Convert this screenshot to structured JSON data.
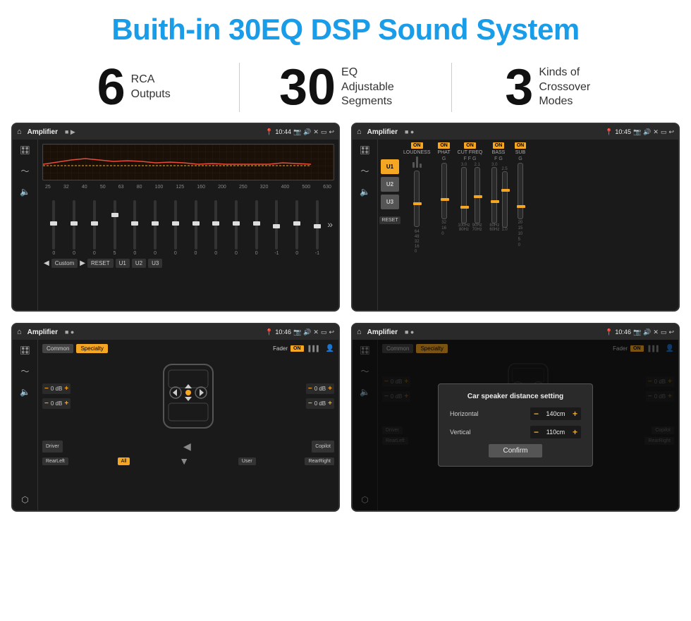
{
  "title": "Buith-in 30EQ DSP Sound System",
  "stats": [
    {
      "number": "6",
      "label": "RCA\nOutputs"
    },
    {
      "number": "30",
      "label": "EQ Adjustable\nSegments"
    },
    {
      "number": "3",
      "label": "Kinds of\nCrossover Modes"
    }
  ],
  "screens": [
    {
      "id": "screen1",
      "app_name": "Amplifier",
      "time": "10:44",
      "type": "eq",
      "freq_labels": [
        "25",
        "32",
        "40",
        "50",
        "63",
        "80",
        "100",
        "125",
        "160",
        "200",
        "250",
        "320",
        "400",
        "500",
        "630"
      ],
      "slider_values": [
        "0",
        "0",
        "0",
        "5",
        "0",
        "0",
        "0",
        "0",
        "0",
        "0",
        "0",
        "-1",
        "0",
        "-1"
      ],
      "bottom_btns": [
        "Custom",
        "RESET",
        "U1",
        "U2",
        "U3"
      ]
    },
    {
      "id": "screen2",
      "app_name": "Amplifier",
      "time": "10:45",
      "type": "amplifier",
      "presets": [
        "U1",
        "U2",
        "U3"
      ],
      "channels": [
        {
          "name": "LOUDNESS",
          "on": true
        },
        {
          "name": "PHAT",
          "on": true
        },
        {
          "name": "CUT FREQ",
          "on": true
        },
        {
          "name": "BASS",
          "on": true
        },
        {
          "name": "SUB",
          "on": true
        }
      ]
    },
    {
      "id": "screen3",
      "app_name": "Amplifier",
      "time": "10:46",
      "type": "fader",
      "tabs": [
        "Common",
        "Specialty"
      ],
      "active_tab": "Specialty",
      "fader_label": "Fader",
      "fader_on": true,
      "speakers": [
        {
          "label": "0 dB",
          "side": "left-top"
        },
        {
          "label": "0 dB",
          "side": "left-bottom"
        },
        {
          "label": "0 dB",
          "side": "right-top"
        },
        {
          "label": "0 dB",
          "side": "right-bottom"
        }
      ],
      "bottom_labels": [
        "Driver",
        "All",
        "User",
        "RearLeft",
        "Copilot",
        "RearRight"
      ]
    },
    {
      "id": "screen4",
      "app_name": "Amplifier",
      "time": "10:46",
      "type": "fader-dialog",
      "tabs": [
        "Common",
        "Specialty"
      ],
      "dialog": {
        "title": "Car speaker distance setting",
        "params": [
          {
            "label": "Horizontal",
            "value": "140cm"
          },
          {
            "label": "Vertical",
            "value": "110cm"
          }
        ],
        "confirm_label": "Confirm"
      }
    }
  ]
}
